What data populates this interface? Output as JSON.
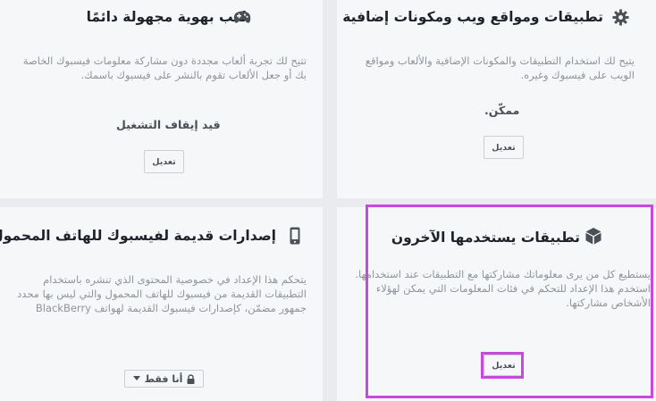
{
  "cards": {
    "games": {
      "title": "لعب بهوية مجهولة دائمًا",
      "icon": "gamepad-icon",
      "description": "تتيح لك تجربة ألعاب مجددة دون مشاركة معلومات فيسبوك الخاصة بك أو جعل الألعاب تقوم بالنشر على فيسبوك باسمك.",
      "status": "قيد إيقاف التشغيل",
      "button": "تعديل"
    },
    "apps": {
      "title": "تطبيقات ومواقع ويب ومكونات إضافية",
      "icon": "gear-icon",
      "description": "يتيح لك استخدام التطبيقات والمكونات الإضافية والألعاب ومواقع الويب على فيسبوك وغيره.",
      "status": "ممكّن.",
      "button": "تعديل"
    },
    "legacy": {
      "title": "إصدارات قديمة لفيسبوك للهاتف المحمول",
      "icon": "mobile-phone-icon",
      "description": "يتحكم هذا الإعداد في خصوصية المحتوى الذي تنشره باستخدام التطبيقات القديمة من فيسبوك للهاتف المحمول والتي ليس بها محدد جمهور مضمّن، كإصدارات فيسبوك القديمة لهواتف BlackBerry",
      "button": "أنا فقط",
      "button_icons": [
        "lock-icon",
        "caret-down-icon"
      ]
    },
    "others": {
      "title": "تطبيقات يستخدمها الآخرون",
      "icon": "box-icon",
      "description": "يستطيع كل من يرى معلوماتك مشاركتها مع التطبيقات عند استخدامها. استخدم هذا الإعداد للتحكم في فئات المعلومات التي يمكن لهؤلاء الأشخاص مشاركتها.",
      "button": "تعديل"
    }
  },
  "colors": {
    "highlight": "#c849e0",
    "title": "#1d2129",
    "text": "#90949c",
    "background": "#e9ebee",
    "card": "#f6f7f9"
  }
}
